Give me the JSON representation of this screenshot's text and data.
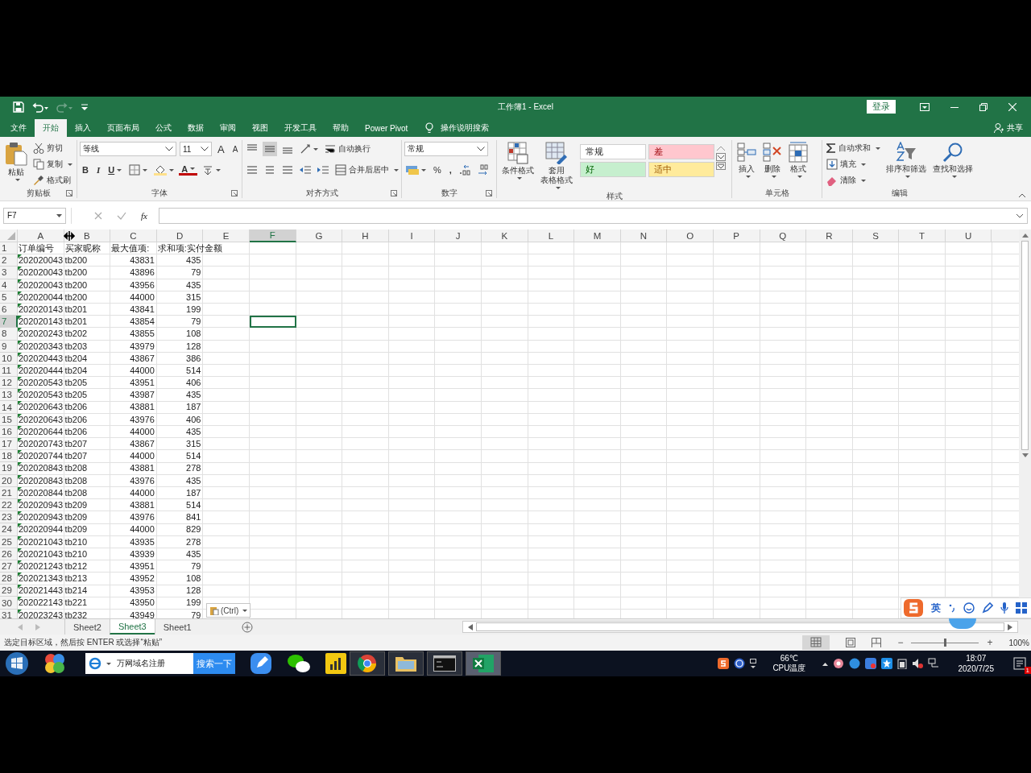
{
  "window": {
    "title": "工作簿1 - Excel",
    "sign_in": "登录"
  },
  "tabs": [
    {
      "label": "文件",
      "selected": false
    },
    {
      "label": "开始",
      "selected": true
    },
    {
      "label": "插入",
      "selected": false
    },
    {
      "label": "页面布局",
      "selected": false
    },
    {
      "label": "公式",
      "selected": false
    },
    {
      "label": "数据",
      "selected": false
    },
    {
      "label": "审阅",
      "selected": false
    },
    {
      "label": "视图",
      "selected": false
    },
    {
      "label": "开发工具",
      "selected": false
    },
    {
      "label": "帮助",
      "selected": false
    },
    {
      "label": "Power Pivot",
      "selected": false
    }
  ],
  "tell_me": "操作说明搜索",
  "share": "共享",
  "ribbon": {
    "groups": [
      {
        "kind": "clipboard",
        "label": "剪贴板",
        "large": "粘贴",
        "small": [
          "剪切",
          "复制",
          "格式刷"
        ]
      },
      {
        "kind": "font",
        "label": "字体",
        "font": "等线",
        "size": "11",
        "grow": "A",
        "shrink": "A",
        "bold": "B",
        "italic": "I",
        "underline": "U",
        "font_color": "A"
      },
      {
        "kind": "align",
        "label": "对齐方式",
        "wrap": "自动换行",
        "merge": "合并后居中"
      },
      {
        "kind": "number",
        "label": "数字",
        "format": "常规",
        "percent": "%",
        "comma": ","
      },
      {
        "kind": "styles",
        "label": "样式",
        "large": [
          [
            "条件格式"
          ],
          [
            "套用",
            "表格格式"
          ]
        ],
        "cells": [
          {
            "label": "常规",
            "color": "#ffffff"
          },
          {
            "label": "差",
            "color": "#ffc7ce"
          },
          {
            "label": "好",
            "color": "#c6efce"
          },
          {
            "label": "适中",
            "color": "#ffeb9c"
          }
        ]
      },
      {
        "kind": "cells",
        "label": "单元格",
        "large": [
          "插入",
          "删除",
          "格式"
        ]
      },
      {
        "kind": "editing",
        "label": "编辑",
        "small": [
          "自动求和",
          "填充",
          "清除"
        ],
        "large": [
          "排序和筛选",
          "查找和选择"
        ]
      }
    ]
  },
  "formula_bar": {
    "name_box": "F7",
    "fx": "fx"
  },
  "grid": {
    "columns": [
      {
        "label": "A",
        "selected": false
      },
      {
        "label": "B",
        "selected": false
      },
      {
        "label": "C",
        "selected": false
      },
      {
        "label": "D",
        "selected": false
      },
      {
        "label": "E",
        "selected": false
      },
      {
        "label": "F",
        "selected": true
      },
      {
        "label": "G",
        "selected": false
      },
      {
        "label": "H",
        "selected": false
      },
      {
        "label": "I",
        "selected": false
      },
      {
        "label": "J",
        "selected": false
      },
      {
        "label": "K",
        "selected": false
      },
      {
        "label": "L",
        "selected": false
      },
      {
        "label": "M",
        "selected": false
      },
      {
        "label": "N",
        "selected": false
      },
      {
        "label": "O",
        "selected": false
      },
      {
        "label": "P",
        "selected": false
      },
      {
        "label": "Q",
        "selected": false
      },
      {
        "label": "R",
        "selected": false
      },
      {
        "label": "S",
        "selected": false
      },
      {
        "label": "T",
        "selected": false
      },
      {
        "label": "U",
        "selected": false
      }
    ],
    "rows": [
      {
        "number": "1",
        "selected": false,
        "mark": false,
        "cells": [
          "订单编号",
          "买家昵称",
          "最大值项:",
          "求和项:实付金额"
        ]
      },
      {
        "number": "2",
        "selected": false,
        "mark": true,
        "cells": [
          "202020043",
          "tb200",
          "43831",
          "435"
        ]
      },
      {
        "number": "3",
        "selected": false,
        "mark": true,
        "cells": [
          "202020043",
          "tb200",
          "43896",
          "79"
        ]
      },
      {
        "number": "4",
        "selected": false,
        "mark": true,
        "cells": [
          "202020043",
          "tb200",
          "43956",
          "435"
        ]
      },
      {
        "number": "5",
        "selected": false,
        "mark": true,
        "cells": [
          "202020044",
          "tb200",
          "44000",
          "315"
        ]
      },
      {
        "number": "6",
        "selected": false,
        "mark": true,
        "cells": [
          "202020143",
          "tb201",
          "43841",
          "199"
        ]
      },
      {
        "number": "7",
        "selected": true,
        "mark": true,
        "cells": [
          "202020143",
          "tb201",
          "43854",
          "79"
        ]
      },
      {
        "number": "8",
        "selected": false,
        "mark": true,
        "cells": [
          "202020243",
          "tb202",
          "43855",
          "108"
        ]
      },
      {
        "number": "9",
        "selected": false,
        "mark": true,
        "cells": [
          "202020343",
          "tb203",
          "43979",
          "128"
        ]
      },
      {
        "number": "10",
        "selected": false,
        "mark": true,
        "cells": [
          "202020443",
          "tb204",
          "43867",
          "386"
        ]
      },
      {
        "number": "11",
        "selected": false,
        "mark": true,
        "cells": [
          "202020444",
          "tb204",
          "44000",
          "514"
        ]
      },
      {
        "number": "12",
        "selected": false,
        "mark": true,
        "cells": [
          "202020543",
          "tb205",
          "43951",
          "406"
        ]
      },
      {
        "number": "13",
        "selected": false,
        "mark": true,
        "cells": [
          "202020543",
          "tb205",
          "43987",
          "435"
        ]
      },
      {
        "number": "14",
        "selected": false,
        "mark": true,
        "cells": [
          "202020643",
          "tb206",
          "43881",
          "187"
        ]
      },
      {
        "number": "15",
        "selected": false,
        "mark": true,
        "cells": [
          "202020643",
          "tb206",
          "43976",
          "406"
        ]
      },
      {
        "number": "16",
        "selected": false,
        "mark": true,
        "cells": [
          "202020644",
          "tb206",
          "44000",
          "435"
        ]
      },
      {
        "number": "17",
        "selected": false,
        "mark": true,
        "cells": [
          "202020743",
          "tb207",
          "43867",
          "315"
        ]
      },
      {
        "number": "18",
        "selected": false,
        "mark": true,
        "cells": [
          "202020744",
          "tb207",
          "44000",
          "514"
        ]
      },
      {
        "number": "19",
        "selected": false,
        "mark": true,
        "cells": [
          "202020843",
          "tb208",
          "43881",
          "278"
        ]
      },
      {
        "number": "20",
        "selected": false,
        "mark": true,
        "cells": [
          "202020843",
          "tb208",
          "43976",
          "435"
        ]
      },
      {
        "number": "21",
        "selected": false,
        "mark": true,
        "cells": [
          "202020844",
          "tb208",
          "44000",
          "187"
        ]
      },
      {
        "number": "22",
        "selected": false,
        "mark": true,
        "cells": [
          "202020943",
          "tb209",
          "43881",
          "514"
        ]
      },
      {
        "number": "23",
        "selected": false,
        "mark": true,
        "cells": [
          "202020943",
          "tb209",
          "43976",
          "841"
        ]
      },
      {
        "number": "24",
        "selected": false,
        "mark": true,
        "cells": [
          "202020944",
          "tb209",
          "44000",
          "829"
        ]
      },
      {
        "number": "25",
        "selected": false,
        "mark": true,
        "cells": [
          "202021043",
          "tb210",
          "43935",
          "278"
        ]
      },
      {
        "number": "26",
        "selected": false,
        "mark": true,
        "cells": [
          "202021043",
          "tb210",
          "43939",
          "435"
        ]
      },
      {
        "number": "27",
        "selected": false,
        "mark": true,
        "cells": [
          "202021243",
          "tb212",
          "43951",
          "79"
        ]
      },
      {
        "number": "28",
        "selected": false,
        "mark": true,
        "cells": [
          "202021343",
          "tb213",
          "43952",
          "108"
        ]
      },
      {
        "number": "29",
        "selected": false,
        "mark": true,
        "cells": [
          "202021443",
          "tb214",
          "43953",
          "128"
        ]
      },
      {
        "number": "30",
        "selected": false,
        "mark": true,
        "cells": [
          "202022143",
          "tb221",
          "43950",
          "199"
        ]
      },
      {
        "number": "31",
        "selected": false,
        "mark": true,
        "cells": [
          "202023243",
          "tb232",
          "43949",
          "79"
        ]
      }
    ]
  },
  "paste_options": "(Ctrl)",
  "ime": {
    "mode": "英"
  },
  "sheets": [
    {
      "label": "Sheet2",
      "selected": false
    },
    {
      "label": "Sheet3",
      "selected": true
    },
    {
      "label": "Sheet1",
      "selected": false
    }
  ],
  "status_bar": {
    "message": "选定目标区域，然后按 ENTER 或选择“粘贴”",
    "zoom": {
      "minus": "−",
      "plus": "+",
      "level": 0.5,
      "reading": "100%"
    }
  },
  "taskbar": {
    "search_text": "万网域名注册",
    "search_button": "搜索一下",
    "temperature": "66℃",
    "temperature_label": "CPU温度",
    "time": "18:07",
    "date": "2020/7/25",
    "notifications": "1"
  }
}
